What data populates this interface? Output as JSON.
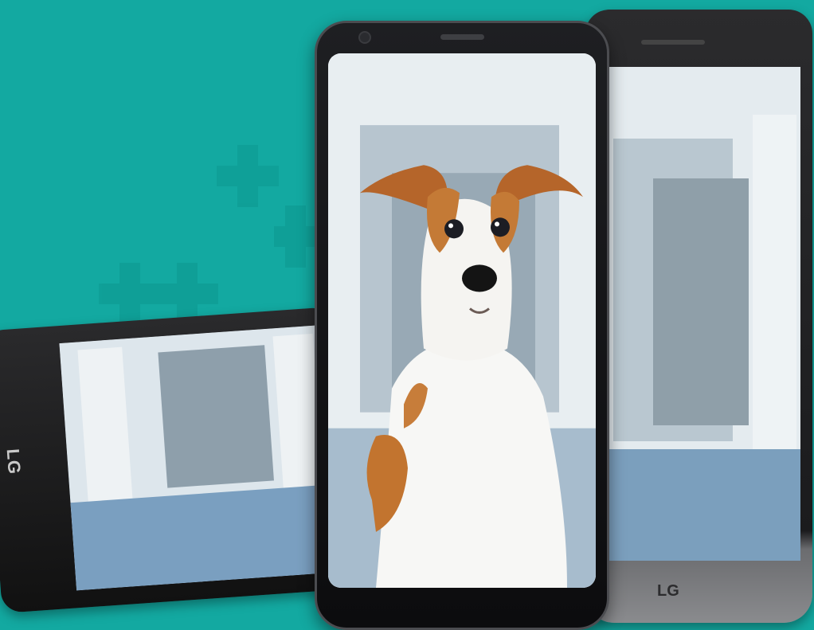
{
  "scene": {
    "background_color": "#13a9a1",
    "subject": "dog",
    "brand_logo_left": "LG",
    "brand_logo_right": "LG"
  }
}
